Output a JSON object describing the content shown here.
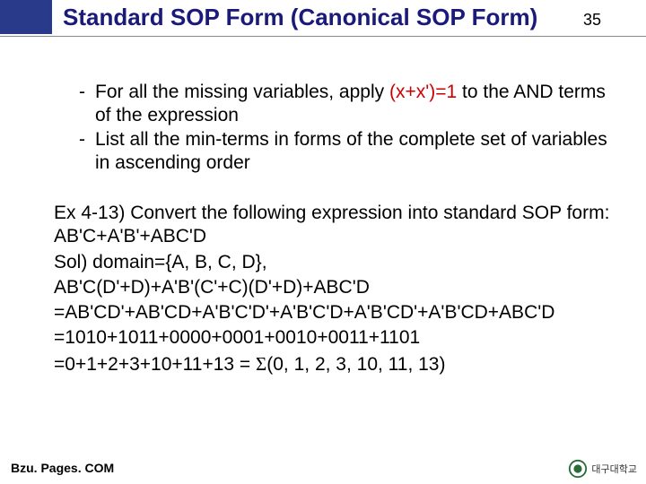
{
  "header": {
    "title": "Standard SOP Form (Canonical SOP Form)",
    "page_number": "35"
  },
  "bullets": [
    {
      "prefix": "For all the missing variables, apply ",
      "highlight": "(x+x')=1",
      "suffix": " to the AND terms of the expression"
    },
    {
      "prefix": "List all the min-terms in forms of the complete set of variables in ascending order",
      "highlight": "",
      "suffix": ""
    }
  ],
  "example": {
    "line1": "Ex 4-13) Convert the following expression into standard SOP form:  AB'C+A'B'+ABC'D",
    "line2": "Sol) domain={A, B, C, D},",
    "line3": "AB'C(D'+D)+A'B'(C'+C)(D'+D)+ABC'D",
    "line4": "=AB'CD'+AB'CD+A'B'C'D'+A'B'C'D+A'B'CD'+A'B'CD+ABC'D",
    "line5": "=1010+1011+0000+0001+0010+0011+1101",
    "line6_prefix": "=0+1+2+3+10+11+13 = ",
    "line6_sigma": "Σ",
    "line6_suffix": "(0, 1, 2, 3, 10, 11, 13)"
  },
  "footer": {
    "left": "Bzu. Pages. COM",
    "right": "대구대학교"
  }
}
